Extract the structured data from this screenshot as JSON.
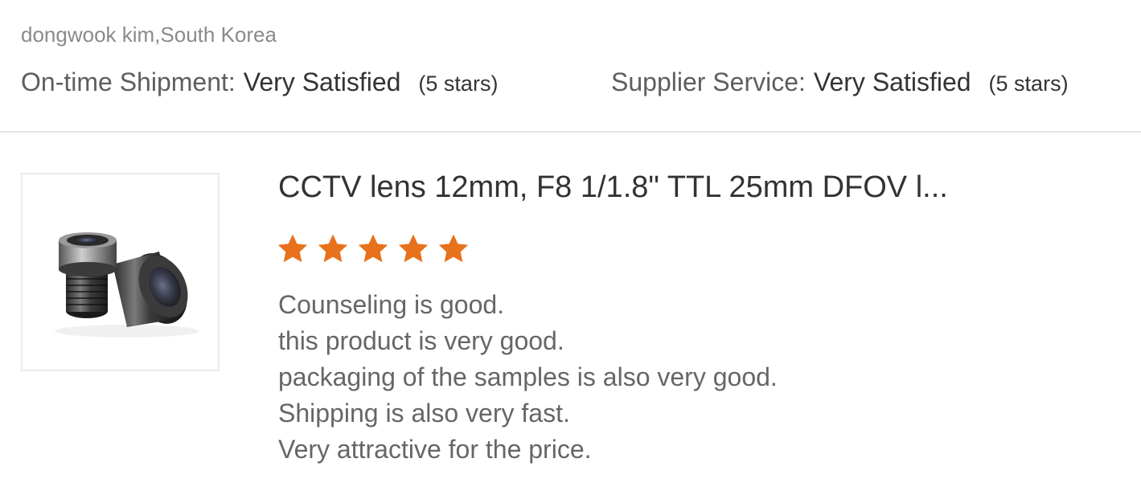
{
  "reviewer": {
    "name_location": "dongwook kim,South Korea"
  },
  "ratings": {
    "shipment": {
      "label": "On-time Shipment:",
      "value": "Very Satisfied",
      "stars_text": "(5 stars)",
      "stars": 5
    },
    "service": {
      "label": "Supplier Service:",
      "value": "Very Satisfied",
      "stars_text": "(5 stars)",
      "stars": 5
    }
  },
  "product": {
    "title": "CCTV lens 12mm, F8 1/1.8\" TTL 25mm DFOV l...",
    "image_icon": "cctv-lens-image",
    "rating": 5,
    "rating_max": 5,
    "star_color": "#e8711c"
  },
  "review": {
    "lines": [
      "Counseling is good.",
      "this product is very good.",
      "packaging of the samples is also very good.",
      "Shipping is also very fast.",
      "Very attractive for the price."
    ]
  }
}
